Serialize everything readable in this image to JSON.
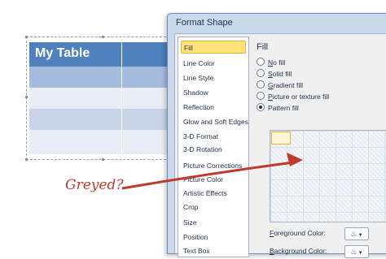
{
  "table": {
    "title": "My Table"
  },
  "dialog": {
    "title": "Format Shape",
    "nav_items": [
      {
        "label": "Fill",
        "selected": true
      },
      {
        "label": "Line Color"
      },
      {
        "label": "Line Style"
      },
      {
        "label": "Shadow"
      },
      {
        "label": "Reflection"
      },
      {
        "label": "Glow and Soft Edges"
      },
      {
        "label": "3-D Format"
      },
      {
        "label": "3-D Rotation"
      },
      {
        "label": "Picture Corrections"
      },
      {
        "label": "Picture Color"
      },
      {
        "label": "Artistic Effects"
      },
      {
        "label": "Crop"
      },
      {
        "label": "Size"
      },
      {
        "label": "Position"
      },
      {
        "label": "Text Box"
      }
    ],
    "panel": {
      "heading": "Fill",
      "options": [
        {
          "u": "N",
          "rest": "o fill",
          "checked": false
        },
        {
          "u": "S",
          "rest": "olid fill",
          "checked": false
        },
        {
          "u": "G",
          "rest": "radient fill",
          "checked": false
        },
        {
          "u": "P",
          "rest": "icture or texture fill",
          "checked": false
        },
        {
          "u": "",
          "rest": "Pattern fill",
          "checked": true
        }
      ],
      "foreground_label_u": "F",
      "foreground_label_rest": "oreground Color:",
      "background_label_u": "B",
      "background_label_rest": "ackground Color:"
    }
  },
  "annotation": {
    "text": "Greyed?",
    "color": "#c0392b"
  },
  "colors": {
    "table_header": "#4f81bd",
    "nav_selected": "#ffe27a"
  }
}
